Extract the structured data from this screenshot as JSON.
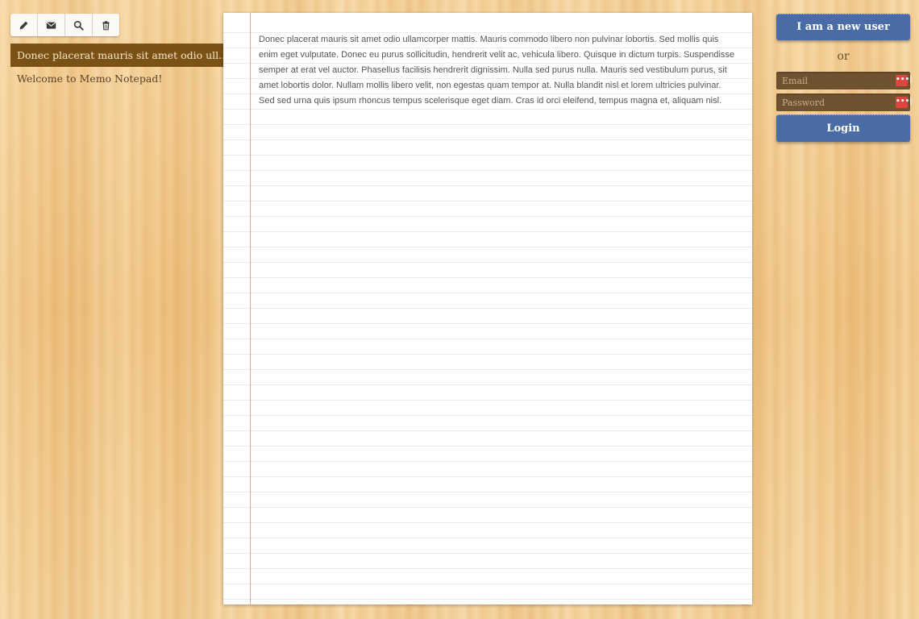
{
  "toolbar": {
    "buttons": [
      {
        "icon": "pencil-icon",
        "name": "new-note-button"
      },
      {
        "icon": "envelope-icon",
        "name": "email-note-button"
      },
      {
        "icon": "search-icon",
        "name": "search-button"
      },
      {
        "icon": "trash-icon",
        "name": "delete-note-button"
      }
    ]
  },
  "notes": [
    {
      "title": "Donec placerat mauris sit amet odio ull...",
      "active": true
    },
    {
      "title": "Welcome to Memo Notepad!",
      "active": false
    }
  ],
  "editor": {
    "text": "Donec placerat mauris sit amet odio ullamcorper mattis. Mauris commodo libero non pulvinar lobortis. Sed mollis quis enim eget vulputate. Donec eu purus sollicitudin, hendrerit velit ac, vehicula libero. Quisque in dictum turpis. Suspendisse semper at erat vel auctor. Phasellus facilisis hendrerit dignissim. Nulla sed purus nulla. Mauris sed vestibulum purus, sit amet lobortis dolor. Nullam mollis libero velit, non egestas quam tempor at. Nulla blandit nisl et lorem ultricies pulvinar. Sed sed urna quis ipsum rhoncus tempus scelerisque eget diam. Cras id orci eleifend, tempus magna et, aliquam nisl."
  },
  "auth": {
    "new_user_label": "I am a new user",
    "or_label": "or",
    "email_placeholder": "Email",
    "password_placeholder": "Password",
    "password_manager_badge": "•••|",
    "login_label": "Login"
  },
  "colors": {
    "accent_blue": "#4a6ca6",
    "active_note_bg": "#7a5216",
    "field_bg": "#6f5331",
    "margin_line": "#e9a7a7"
  }
}
